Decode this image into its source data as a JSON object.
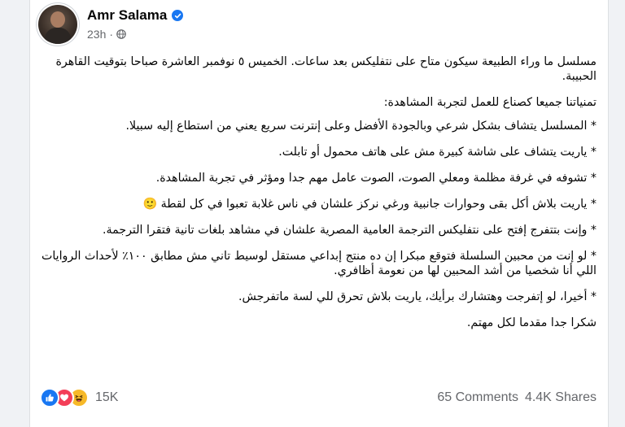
{
  "post": {
    "author": "Amr Salama",
    "time": "23h",
    "audience_icon": "globe-icon",
    "verified_icon": "verified-badge-icon",
    "paragraphs": [
      "مسلسل ما وراء الطبيعة سيكون متاح على نتفليكس بعد ساعات. الخميس ٥ نوفمبر العاشرة صباحا بتوقيت القاهرة الحبيبة.",
      "تمنياتنا جميعا كصناع للعمل لتجربة المشاهدة:",
      "* المسلسل يتشاف بشكل شرعي وبالجودة الأفضل وعلى إنترنت سريع يعني من استطاع إليه سبيلا.",
      "* ياريت يتشاف على شاشة كبيرة مش على هاتف محمول أو تابلت.",
      "* تشوفه في غرفة مظلمة ومعلي الصوت، الصوت عامل مهم جدا ومؤثر في تجربة المشاهدة.",
      "* ياريت بلاش أكل بقى وحوارات جانبية ورغي نركز علشان في ناس غلابة تعبوا في كل لقطة 🙂",
      "* وإنت بتتفرج إفتح على نتفليكس الترجمة العامية المصرية علشان في مشاهد بلغات تانية فتقرا الترجمة.",
      "* لو إنت من محبين السلسلة فتوقع مبكرا إن ده منتج إبداعي مستقل لوسيط تاني مش مطابق ١٠٠٪ لأحداث الروايات اللي أنا شخصيا من أشد المحبين لها من نعومة أظافري.",
      "* أخيرا، لو إتفرجت وهتشارك برأيك، ياريت بلاش تحرق للي لسة ماتفرجش.",
      "شكرا جدا مقدما لكل مهتم."
    ]
  },
  "footer": {
    "reaction_icons": [
      "like-icon",
      "love-icon",
      "haha-icon"
    ],
    "reaction_count": "15K",
    "comments": "65 Comments",
    "shares": "4.4K Shares"
  },
  "colors": {
    "brand_blue": "#1877f2",
    "text_primary": "#050505",
    "text_secondary": "#65676b",
    "love_red": "#f33e58",
    "haha_yellow": "#f7b928"
  }
}
